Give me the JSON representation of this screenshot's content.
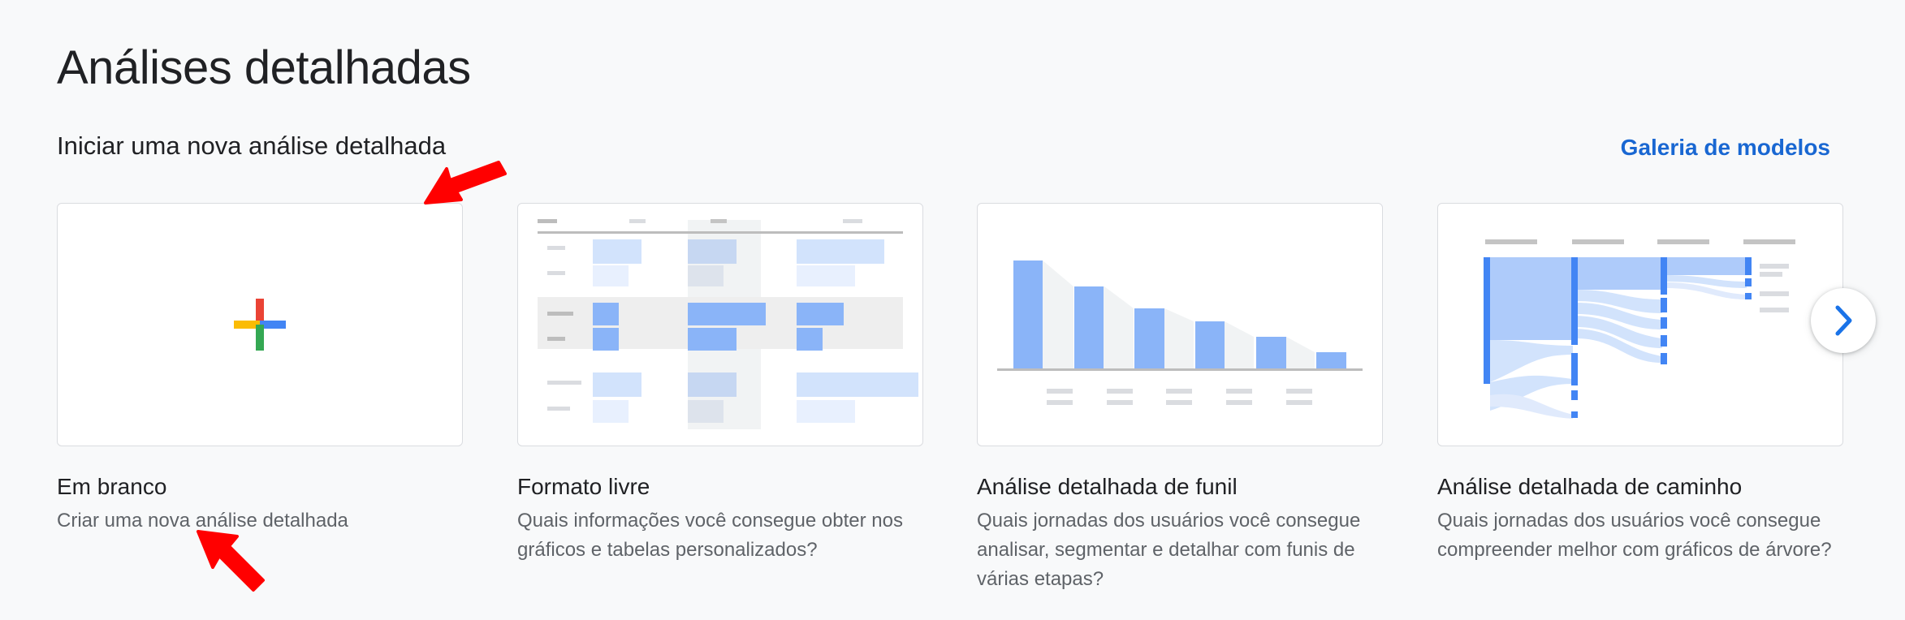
{
  "header": {
    "title": "Análises detalhadas"
  },
  "section": {
    "title": "Iniciar uma nova análise detalhada",
    "gallery_link": "Galeria de modelos"
  },
  "cards": [
    {
      "title": "Em branco",
      "description": "Criar uma nova análise detalhada",
      "icon": "plus-icon"
    },
    {
      "title": "Formato livre",
      "description": "Quais informações você consegue obter nos gráficos e tabelas personalizados?",
      "icon": "table-preview"
    },
    {
      "title": "Análise detalhada de funil",
      "description": "Quais jornadas dos usuários você consegue analisar, segmentar e detalhar com funis de várias etapas?",
      "icon": "funnel-preview"
    },
    {
      "title": "Análise detalhada de caminho",
      "description": "Quais jornadas dos usuários você consegue compreender melhor com gráficos de árvore?",
      "icon": "tree-preview"
    }
  ],
  "carousel": {
    "next_icon": "chevron-right-icon"
  },
  "colors": {
    "accent": "#1967d2",
    "bar_blue": "#8ab4f8",
    "light_blue": "#d2e3fc",
    "annotation_red": "#ff0000"
  }
}
